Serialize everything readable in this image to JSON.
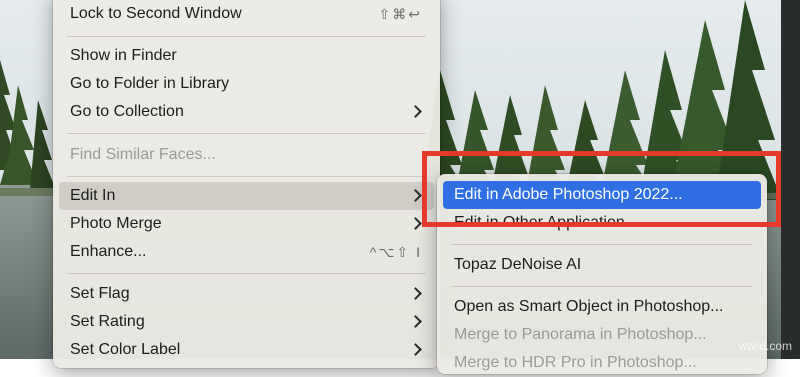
{
  "main_menu": {
    "lock_second_window": {
      "label": "Lock to Second Window",
      "shortcut": "⇧⌘↩"
    },
    "show_in_finder": "Show in Finder",
    "go_to_folder": "Go to Folder in Library",
    "go_to_collection": "Go to Collection",
    "find_similar_faces": "Find Similar Faces...",
    "edit_in": "Edit In",
    "photo_merge": "Photo Merge",
    "enhance": {
      "label": "Enhance...",
      "shortcut": "^⌥⇧ I"
    },
    "set_flag": "Set Flag",
    "set_rating": "Set Rating",
    "set_color_label": "Set Color Label"
  },
  "sub_menu": {
    "edit_photoshop": "Edit in Adobe Photoshop 2022...",
    "edit_other": "Edit in Other Application...",
    "topaz": "Topaz DeNoise AI",
    "smart_object": "Open as Smart Object in Photoshop...",
    "merge_panorama": "Merge to Panorama in Photoshop...",
    "merge_hdr": "Merge to HDR Pro in Photoshop..."
  },
  "watermark": "wtvid.com",
  "colors": {
    "highlight": "#2f6fe3",
    "annotation": "#e53a2a"
  }
}
